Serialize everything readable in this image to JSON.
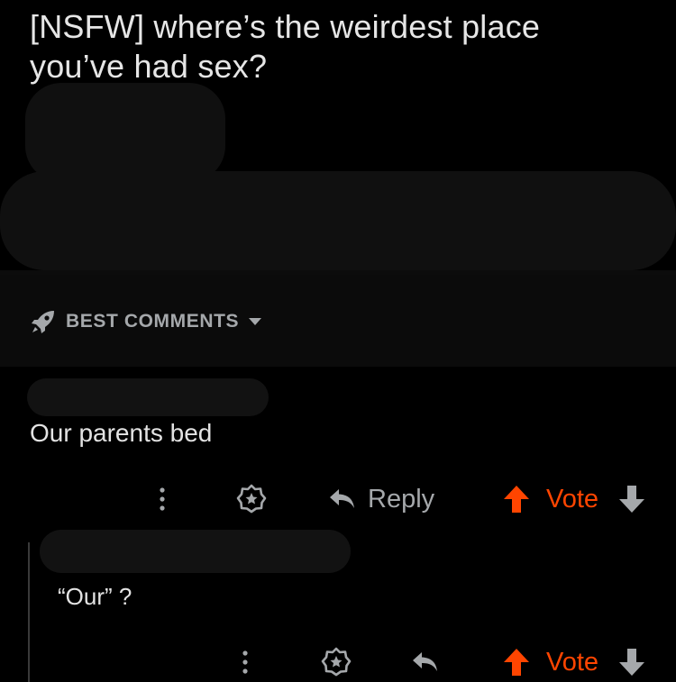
{
  "post": {
    "title": "[NSFW] where’s the weirdest place you’ve had sex?"
  },
  "sort": {
    "icon": "rocket-icon",
    "label": "BEST COMMENTS",
    "dropdown_icon": "caret-down-icon"
  },
  "comments": [
    {
      "text": "Our parents bed",
      "actions": {
        "more_icon": "more-vertical-icon",
        "award_icon": "award-icon",
        "reply_icon": "reply-arrow-icon",
        "reply_label": "Reply",
        "upvote_icon": "upvote-arrow-icon",
        "vote_label": "Vote",
        "downvote_icon": "downvote-arrow-icon"
      }
    },
    {
      "text": "“Our” ?",
      "actions": {
        "more_icon": "more-vertical-icon",
        "award_icon": "award-icon",
        "reply_icon": "reply-arrow-icon",
        "upvote_icon": "upvote-arrow-icon",
        "vote_label": "Vote",
        "downvote_icon": "downvote-arrow-icon"
      }
    }
  ],
  "colors": {
    "background": "#000000",
    "text": "#e3e3e3",
    "muted": "#a5a8ab",
    "accent_upvote": "#ff4500"
  }
}
